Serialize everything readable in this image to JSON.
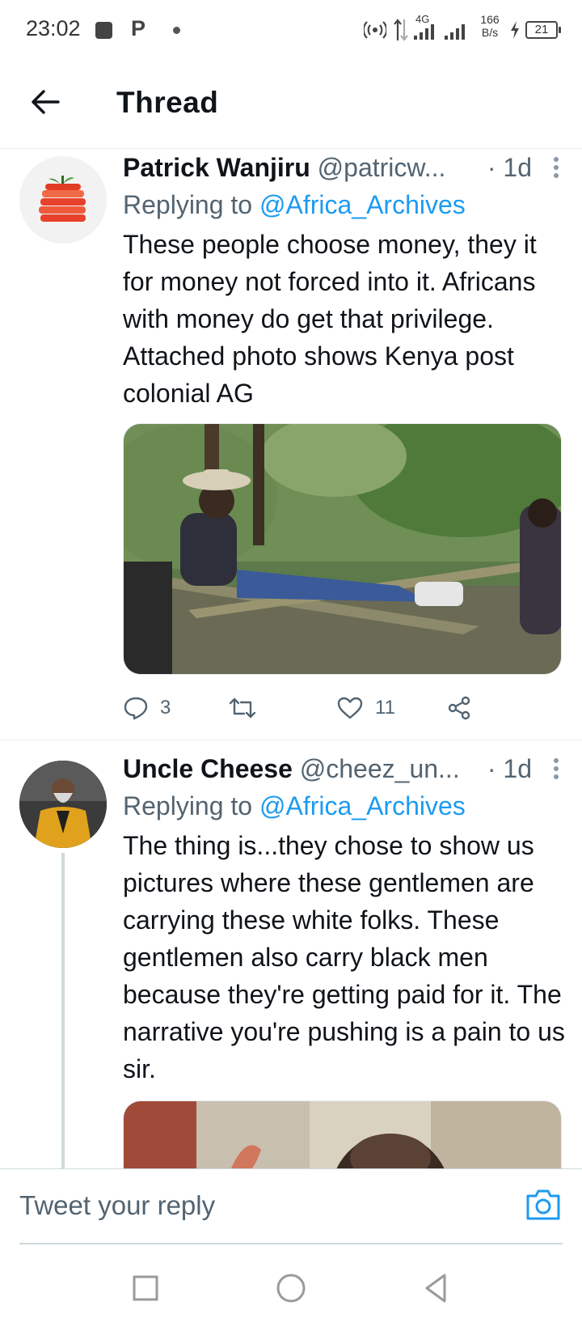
{
  "status_bar": {
    "time": "23:02",
    "notification_icon": "P",
    "network": "4G",
    "speed_value": "166",
    "speed_unit": "B/s",
    "battery": "21"
  },
  "header": {
    "title": "Thread"
  },
  "tweets": [
    {
      "name": "Patrick Wanjiru",
      "handle": "@patricw...",
      "time": "· 1d",
      "replying_prefix": "Replying to",
      "replying_to": "@Africa_Archives",
      "text": "These people choose money, they it for money not forced into it. Africans with money do get that privilege. Attached photo shows Kenya post colonial AG",
      "replies": "3",
      "retweets": "",
      "likes": "11"
    },
    {
      "name": "Uncle Cheese",
      "handle": "@cheez_un...",
      "time": "· 1d",
      "replying_prefix": "Replying to",
      "replying_to": "@Africa_Archives",
      "text": "The thing is...they chose to show us pictures where these gentlemen are carrying these white folks. These gentlemen also carry black men because they're getting paid for it. The narrative you're pushing is a pain to us sir."
    }
  ],
  "reply_bar": {
    "placeholder": "Tweet your reply"
  },
  "colors": {
    "accent": "#1d9bf0",
    "text": "#0f1419",
    "secondary": "#536471",
    "divider": "#e6ecf0"
  },
  "icons": [
    "back-arrow-icon",
    "more-icon",
    "reply-icon",
    "retweet-icon",
    "like-icon",
    "share-icon",
    "camera-icon",
    "nav-recents-icon",
    "nav-home-icon",
    "nav-back-icon"
  ]
}
